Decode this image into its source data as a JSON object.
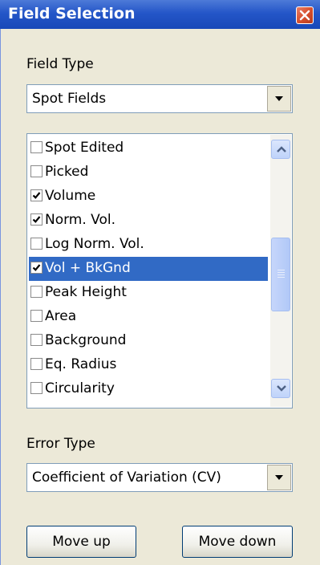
{
  "window": {
    "title": "Field Selection"
  },
  "field_type": {
    "label": "Field Type",
    "value": "Spot Fields"
  },
  "fields": [
    {
      "label": "Spot Edited",
      "checked": false,
      "selected": false
    },
    {
      "label": "Picked",
      "checked": false,
      "selected": false
    },
    {
      "label": "Volume",
      "checked": true,
      "selected": false
    },
    {
      "label": "Norm. Vol.",
      "checked": true,
      "selected": false
    },
    {
      "label": "Log Norm. Vol.",
      "checked": false,
      "selected": false
    },
    {
      "label": "Vol + BkGnd",
      "checked": true,
      "selected": true
    },
    {
      "label": "Peak Height",
      "checked": false,
      "selected": false
    },
    {
      "label": "Area",
      "checked": false,
      "selected": false
    },
    {
      "label": "Background",
      "checked": false,
      "selected": false
    },
    {
      "label": "Eq. Radius",
      "checked": false,
      "selected": false
    },
    {
      "label": "Circularity",
      "checked": false,
      "selected": false
    }
  ],
  "error_type": {
    "label": "Error Type",
    "value": "Coefficient of Variation (CV)"
  },
  "buttons": {
    "move_up": "Move up",
    "move_down": "Move down"
  },
  "colors": {
    "titlebar": "#2456c8",
    "selection": "#316ac5",
    "dialog": "#ece9d8"
  },
  "icons": {
    "close": "close-icon",
    "dropdown": "chevron-down-icon",
    "scroll_up": "chevron-up-icon",
    "scroll_down": "chevron-down-icon",
    "checkbox": "checkmark-icon"
  }
}
